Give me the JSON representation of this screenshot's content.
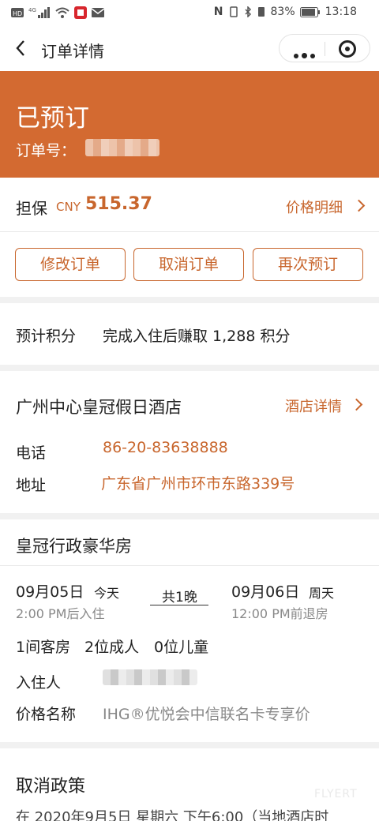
{
  "status_bar": {
    "left_icons": [
      "hd-icon",
      "4g-icon",
      "signal-icon",
      "wifi-icon",
      "app-notification-icon",
      "mail-icon"
    ],
    "nfc": "N",
    "battery_percent": "83%",
    "time": "13:18"
  },
  "nav": {
    "title": "订单详情"
  },
  "header": {
    "status": "已预订",
    "order_label": "订单号："
  },
  "payment": {
    "label": "担保",
    "currency": "CNY",
    "amount": "515.37",
    "detail_link": "价格明细"
  },
  "actions": {
    "modify": "修改订单",
    "cancel": "取消订单",
    "rebook": "再次预订"
  },
  "points": {
    "label": "预计积分",
    "text": "完成入住后赚取 1,288 积分"
  },
  "hotel": {
    "name": "广州中心皇冠假日酒店",
    "detail_link": "酒店详情",
    "phone_label": "电话",
    "phone": "86-20-83638888",
    "address_label": "地址",
    "address": "广东省广州市环市东路339号"
  },
  "room": {
    "type": "皇冠行政豪华房",
    "checkin_date": "09月05日",
    "checkin_day": "今天",
    "checkin_time": "2:00 PM后入住",
    "nights": "共1晚",
    "checkout_date": "09月06日",
    "checkout_day": "周天",
    "checkout_time": "12:00 PM前退房",
    "rooms": "1间客房",
    "adults": "2位成人",
    "children": "0位儿童",
    "guest_label": "入住人",
    "rate_label": "价格名称",
    "rate_name": "IHG®优悦会中信联名卡专享价"
  },
  "cancellation": {
    "title": "取消政策",
    "text": "在 2020年9月5日 星期六 下午6:00（当地酒店时"
  },
  "watermark": "FLYERT",
  "colors": {
    "accent": "#d36a31",
    "link": "#c8662d"
  }
}
